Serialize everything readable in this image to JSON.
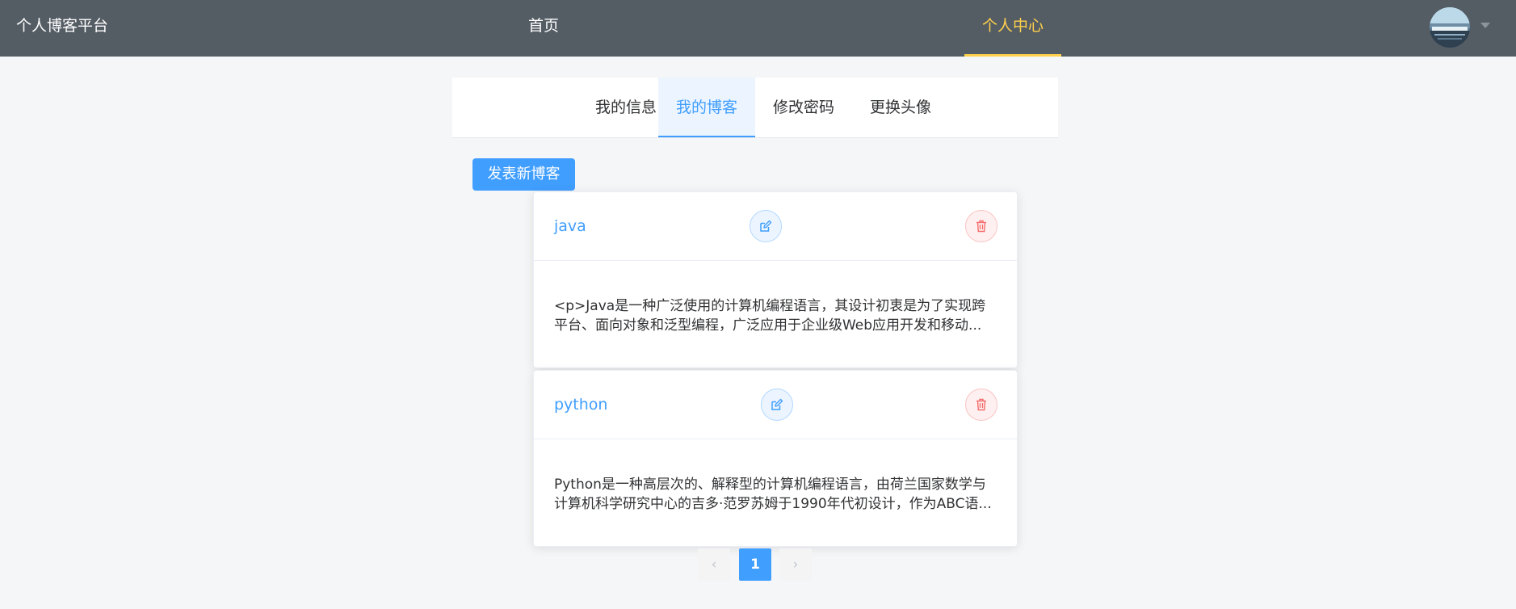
{
  "navbar": {
    "brand": "个人博客平台",
    "items": [
      {
        "label": "首页",
        "active": false
      },
      {
        "label": "个人中心",
        "active": true
      }
    ],
    "active_color": "#ffd04b",
    "background": "#545c64"
  },
  "tabs": [
    {
      "label": "我的信息",
      "active": false
    },
    {
      "label": "我的博客",
      "active": true
    },
    {
      "label": "修改密码",
      "active": false
    },
    {
      "label": "更换头像",
      "active": false
    }
  ],
  "actions": {
    "new_post_label": "发表新博客"
  },
  "blogs": [
    {
      "title": "java",
      "excerpt_lines": [
        "<p>Java是一种广泛使用的计算机编程语言，其设计初衷是为了实现跨",
        "平台、面向对象和泛型编程，广泛应用于企业级Web应用开发和移动..."
      ],
      "edit_icon": "edit-icon",
      "delete_icon": "trash-icon"
    },
    {
      "title": "python",
      "excerpt_lines": [
        "Python是一种高层次的、解释型的计算机编程语言，由荷兰国家数学与",
        "计算机科学研究中心的吉多·范罗苏姆于1990年代初设计，作为ABC语..."
      ],
      "edit_icon": "edit-icon",
      "delete_icon": "trash-icon"
    }
  ],
  "pagination": {
    "prev_symbol": "‹",
    "current_page": "1",
    "next_symbol": "›"
  },
  "colors": {
    "primary": "#409eff",
    "danger": "#f56c6c"
  }
}
